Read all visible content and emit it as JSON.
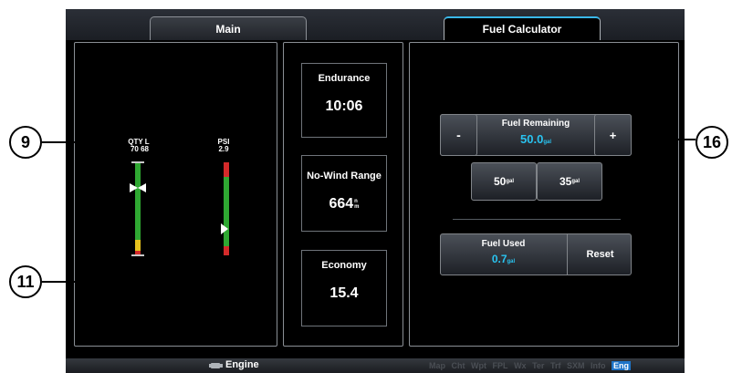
{
  "tabs": [
    {
      "label": "Main"
    },
    {
      "label": "Fuel Calculator"
    }
  ],
  "gauges": {
    "qty": {
      "label": "QTY L",
      "values": "70  68"
    },
    "psi": {
      "label": "PSI",
      "value": "2.9"
    }
  },
  "info": {
    "endurance": {
      "label": "Endurance",
      "value": "10:06"
    },
    "range": {
      "label": "No-Wind Range",
      "value": "664",
      "unit_top": "n",
      "unit_bottom": "m"
    },
    "economy": {
      "label": "Economy",
      "value": "15.4"
    }
  },
  "fuel_calc": {
    "minus_label": "-",
    "plus_label": "+",
    "remaining_label": "Fuel Remaining",
    "remaining_value": "50.0",
    "unit": "gal",
    "preset1_value": "50",
    "preset2_value": "35",
    "used_label": "Fuel Used",
    "used_value": "0.7",
    "reset_label": "Reset"
  },
  "bottom_bar": {
    "page_label": "Engine",
    "nav": [
      "Map",
      "Cht",
      "Wpt",
      "FPL",
      "Wx",
      "Ter",
      "Trf",
      "SXM",
      "Info",
      "Eng"
    ]
  },
  "callouts": [
    "9",
    "11",
    "16"
  ],
  "colors": {
    "accent": "#29c3f0",
    "selected_tab_border": "#39b7e8",
    "gauge_green": "#2fa832",
    "gauge_red": "#d42a2a",
    "gauge_yellow": "#e6c21e"
  }
}
